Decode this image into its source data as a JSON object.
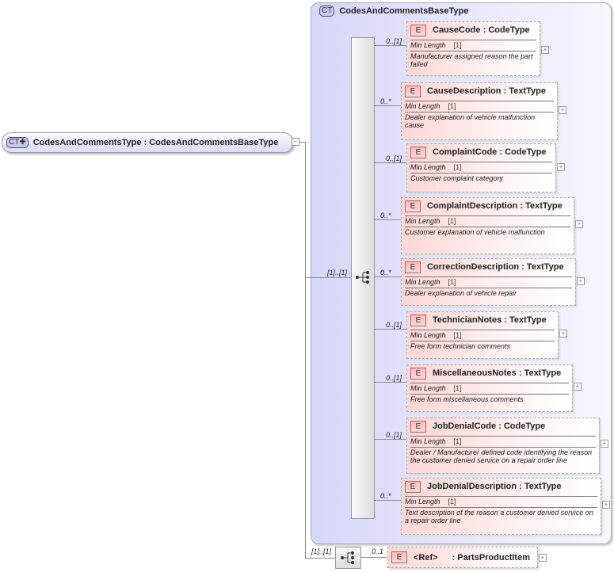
{
  "root": {
    "badge": "CT",
    "name": "CodesAndCommentsType",
    "type": ": CodesAndCommentsBaseType"
  },
  "base": {
    "badge": "CT",
    "name": "CodesAndCommentsBaseType"
  },
  "sequence_multiplicity": "[1]..[1]",
  "elements": [
    {
      "name": "CauseCode",
      "type": ": CodeType",
      "mult": "0..[1]",
      "facet": "Min Length",
      "facet_value": "[1]",
      "doc": "Manufacturer assigned reason the part failed"
    },
    {
      "name": "CauseDescription",
      "type": ": TextType",
      "mult": "0..*",
      "facet": "Min Length",
      "facet_value": "[1]",
      "doc": "Dealer explanation of vehicle malfunction cause"
    },
    {
      "name": "ComplaintCode",
      "type": ": CodeType",
      "mult": "0..[1]",
      "facet": "Min Length",
      "facet_value": "[1]",
      "doc": "Customer complaint category"
    },
    {
      "name": "ComplaintDescription",
      "type": ": TextType",
      "mult": "0..*",
      "facet": "Min Length",
      "facet_value": "[1]",
      "doc": "Customer explanation of vehicle malfunction"
    },
    {
      "name": "CorrectionDescription",
      "type": ": TextType",
      "mult": "0..*",
      "facet": "Min Length",
      "facet_value": "[1]",
      "doc": "Dealer explanation of vehicle repair"
    },
    {
      "name": "TechnicianNotes",
      "type": ": TextType",
      "mult": "0..[1]",
      "facet": "Min Length",
      "facet_value": "[1]",
      "doc": "Free form technician comments"
    },
    {
      "name": "MiscellaneousNotes",
      "type": ": TextType",
      "mult": "0..[1]",
      "facet": "Min Length",
      "facet_value": "[1]",
      "doc": "Free form miscellaneous comments"
    },
    {
      "name": "JobDenialCode",
      "type": ": CodeType",
      "mult": "0..[1]",
      "facet": "Min Length",
      "facet_value": "[1]",
      "doc": "Dealer / Manufacturer defined code identifying the reason the customer denied service on a repair order line"
    },
    {
      "name": "JobDenialDescription",
      "type": ": TextType",
      "mult": "0..*",
      "facet": "Min Length",
      "facet_value": "[1]",
      "doc": "Text description of the reason a customer denied service on a repair order line"
    }
  ],
  "extension": {
    "seq_mult": "[1]..[1]",
    "mult": "0..1",
    "name": "<Ref>",
    "type": ": PartsProductItem"
  },
  "element_badge": "E"
}
